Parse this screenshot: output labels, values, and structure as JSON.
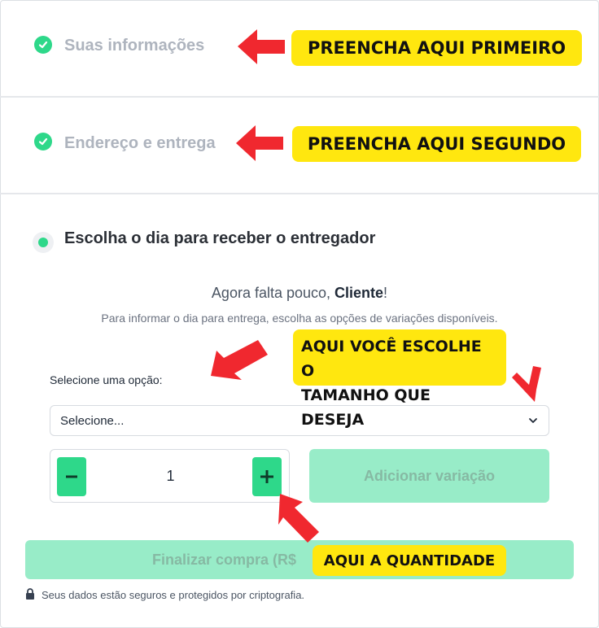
{
  "steps": [
    {
      "title": "Suas informações",
      "status": "complete"
    },
    {
      "title": "Endereço e entrega",
      "status": "complete"
    },
    {
      "title": "Escolha o dia para receber o entregador",
      "status": "active"
    }
  ],
  "delivery": {
    "greeting_prefix": "Agora falta pouco, ",
    "greeting_name": "Cliente",
    "greeting_suffix": "!",
    "instructions": "Para informar o dia para entrega, escolha as opções de variações disponíveis.",
    "select_label": "Selecione uma opção:",
    "select_value": "Selecione...",
    "quantity": "1",
    "add_variation_label": "Adicionar variação"
  },
  "footer": {
    "finish_label": "Finalizar compra (R$",
    "secure_text": "Seus dados estão seguros e protegidos por criptografia."
  },
  "annotations": {
    "first": "PREENCHA AQUI PRIMEIRO",
    "second": "PREENCHA AQUI SEGUNDO",
    "size_line1": "AQUI VOCÊ ESCOLHE O",
    "size_line2": "TAMANHO QUE DESEJA",
    "quantity": "AQUI A QUANTIDADE"
  },
  "colors": {
    "accent": "#2ed88a",
    "accent_disabled": "#98ecc8",
    "callout": "#ffe70f",
    "arrow": "#f0282f"
  },
  "icons": [
    "check-icon",
    "chevron-down-icon",
    "minus-icon",
    "plus-icon",
    "lock-icon",
    "red-arrow"
  ]
}
